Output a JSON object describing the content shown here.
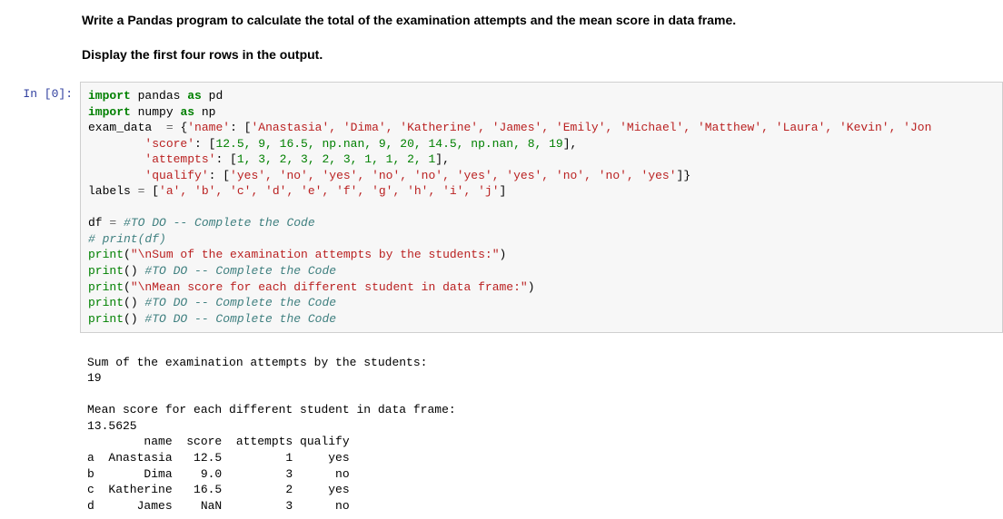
{
  "headings": {
    "h1": "Write a Pandas program to calculate the total of the examination attempts and the mean score in data frame.",
    "h2": "Display the first four rows in the output."
  },
  "prompt": "In [0]:",
  "code": {
    "l1": {
      "import": "import",
      "pandas": "pandas",
      "as": "as",
      "pd": "pd"
    },
    "l2": {
      "import": "import",
      "numpy": "numpy",
      "as": "as",
      "np": "np"
    },
    "l3": {
      "var": "exam_data  ",
      "eq": "=",
      "sp": " {",
      "k1": "'name'",
      "c": ": [",
      "v": "'Anastasia', 'Dima', 'Katherine', 'James', 'Emily', 'Michael', 'Matthew', 'Laura', 'Kevin', 'Jon",
      "end": ""
    },
    "l4": {
      "pad": "        ",
      "k": "'score'",
      "c": ": [",
      "v": "12.5, 9, 16.5, np.nan, 9, 20, 14.5, np.nan, 8, 19",
      "end": "],"
    },
    "l5": {
      "pad": "        ",
      "k": "'attempts'",
      "c": ": [",
      "v": "1, 3, 2, 3, 2, 3, 1, 1, 2, 1",
      "end": "],"
    },
    "l6": {
      "pad": "        ",
      "k": "'qualify'",
      "c": ": [",
      "v": "'yes', 'no', 'yes', 'no', 'no', 'yes', 'yes', 'no', 'no', 'yes'",
      "end": "]}"
    },
    "l7": {
      "var": "labels ",
      "eq": "=",
      "sp": " [",
      "v": "'a', 'b', 'c', 'd', 'e', 'f', 'g', 'h', 'i', 'j'",
      "end": "]"
    },
    "blank1": "",
    "l8": {
      "var": "df ",
      "eq": "=",
      "comment": " #TO DO -- Complete the Code"
    },
    "l9": {
      "comment": "# print(df)"
    },
    "l10": {
      "print": "print",
      "op": "(",
      "str": "\"\\nSum of the examination attempts by the students:\"",
      "cp": ")"
    },
    "l11": {
      "print": "print",
      "op": "() ",
      "comment": "#TO DO -- Complete the Code"
    },
    "l12": {
      "print": "print",
      "op": "(",
      "str": "\"\\nMean score for each different student in data frame:\"",
      "cp": ")"
    },
    "l13": {
      "print": "print",
      "op": "() ",
      "comment": "#TO DO -- Complete the Code"
    },
    "l14": {
      "print": "print",
      "op": "() ",
      "comment": "#TO DO -- Complete the Code"
    }
  },
  "output": {
    "blank0": "",
    "l1": "Sum of the examination attempts by the students:",
    "l2": "19",
    "blank1": "",
    "l3": "Mean score for each different student in data frame:",
    "l4": "13.5625",
    "l5": "        name  score  attempts qualify",
    "l6": "a  Anastasia   12.5         1     yes",
    "l7": "b       Dima    9.0         3      no",
    "l8": "c  Katherine   16.5         2     yes",
    "l9": "d      James    NaN         3      no"
  }
}
